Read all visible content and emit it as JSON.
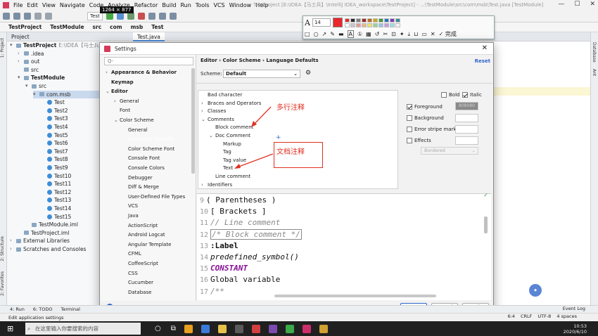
{
  "menubar": [
    "File",
    "Edit",
    "View",
    "Navigate",
    "Code",
    "Analyze",
    "Refactor",
    "Build",
    "Run",
    "Tools",
    "VCS",
    "Window",
    "Help"
  ],
  "window_title": "TestProject [E:\\IDEA【马士兵】\\IntelliJ IDEA_workspace\\TestProject] - ...\\TestModule\\src\\com\\msb\\Test.java [TestModule]",
  "toolbar": {
    "run_config": "Test",
    "dimensions": "1264 × 877"
  },
  "breadcrumbs": [
    "TestProject",
    "TestModule",
    "src",
    "com",
    "msb",
    "Test"
  ],
  "project_panel": {
    "title": "Project",
    "tab": "Test.java",
    "root_label": "TestProject",
    "root_path": "E:\\IDEA【马士兵】",
    "items": [
      "TestProject",
      ".idea",
      "out",
      "src",
      "TestModule",
      "src",
      "com.msb",
      "Test",
      "Test2",
      "Test3",
      "Test4",
      "Test5",
      "Test6",
      "Test7",
      "Test8",
      "Test9",
      "Test10",
      "Test11",
      "Test12",
      "Test13",
      "Test14",
      "Test15",
      "TestModule.iml",
      "TestProject.iml",
      "External Libraries",
      "Scratches and Consoles"
    ]
  },
  "side_tools": {
    "left": [
      "1: Project",
      "2: Structure",
      "2: Favorites"
    ],
    "right": [
      "Database",
      "Ant"
    ]
  },
  "snip_toolbar": {
    "font_size": "14",
    "done_label": "完成",
    "colors": [
      "#e8282c",
      "#2c2c2c",
      "#7f7f7f",
      "#9c2a20",
      "#bf6c1c",
      "#c8a620",
      "#3c9b3a",
      "#2c6fc0",
      "#7b3bb4",
      "#3a8a9a",
      "#ffffff",
      "#c8c8c8",
      "#e29b9a",
      "#ebb88e",
      "#eee26a",
      "#9bd39a",
      "#9bc3e8",
      "#c49ce0",
      "#9be0e8",
      "#f4f4f4"
    ]
  },
  "dialog": {
    "title": "Settings",
    "search_placeholder": "Q-",
    "breadcrumb": "Editor  ›  Color Scheme  ›  Language Defaults",
    "reset": "Reset",
    "scheme_label": "Scheme:",
    "scheme_value": "Default",
    "nav": [
      {
        "label": "Appearance & Behavior",
        "bold": true,
        "arrow": "›",
        "indent": 0
      },
      {
        "label": "Keymap",
        "bold": true,
        "arrow": "",
        "indent": 0
      },
      {
        "label": "Editor",
        "bold": true,
        "arrow": "⌄",
        "indent": 0
      },
      {
        "label": "General",
        "bold": false,
        "arrow": "›",
        "indent": 1
      },
      {
        "label": "Font",
        "bold": false,
        "arrow": "",
        "indent": 1
      },
      {
        "label": "Color Scheme",
        "bold": false,
        "arrow": "⌄",
        "indent": 1
      },
      {
        "label": "General",
        "bold": false,
        "arrow": "",
        "indent": 2
      },
      {
        "label": "Language Defaults",
        "bold": false,
        "arrow": "",
        "indent": 2,
        "selected": true
      },
      {
        "label": "Color Scheme Font",
        "bold": false,
        "arrow": "",
        "indent": 2
      },
      {
        "label": "Console Font",
        "bold": false,
        "arrow": "",
        "indent": 2
      },
      {
        "label": "Console Colors",
        "bold": false,
        "arrow": "",
        "indent": 2
      },
      {
        "label": "Debugger",
        "bold": false,
        "arrow": "",
        "indent": 2
      },
      {
        "label": "Diff & Merge",
        "bold": false,
        "arrow": "",
        "indent": 2
      },
      {
        "label": "User-Defined File Types",
        "bold": false,
        "arrow": "",
        "indent": 2
      },
      {
        "label": "VCS",
        "bold": false,
        "arrow": "",
        "indent": 2
      },
      {
        "label": "Java",
        "bold": false,
        "arrow": "",
        "indent": 2
      },
      {
        "label": "ActionScript",
        "bold": false,
        "arrow": "",
        "indent": 2
      },
      {
        "label": "Android Logcat",
        "bold": false,
        "arrow": "",
        "indent": 2
      },
      {
        "label": "Angular Template",
        "bold": false,
        "arrow": "",
        "indent": 2
      },
      {
        "label": "CFML",
        "bold": false,
        "arrow": "",
        "indent": 2
      },
      {
        "label": "CoffeeScript",
        "bold": false,
        "arrow": "",
        "indent": 2
      },
      {
        "label": "CSS",
        "bold": false,
        "arrow": "",
        "indent": 2
      },
      {
        "label": "Cucumber",
        "bold": false,
        "arrow": "",
        "indent": 2
      },
      {
        "label": "Database",
        "bold": false,
        "arrow": "",
        "indent": 2
      }
    ],
    "attr_tree": [
      {
        "label": "Bad character",
        "arrow": "",
        "indent": 0
      },
      {
        "label": "Braces and Operators",
        "arrow": "›",
        "indent": 0
      },
      {
        "label": "Classes",
        "arrow": "›",
        "indent": 0
      },
      {
        "label": "Comments",
        "arrow": "⌄",
        "indent": 0
      },
      {
        "label": "Block comment",
        "arrow": "",
        "indent": 1,
        "selected": true
      },
      {
        "label": "Doc Comment",
        "arrow": "⌄",
        "indent": 1
      },
      {
        "label": "Markup",
        "arrow": "",
        "indent": 2
      },
      {
        "label": "Tag",
        "arrow": "",
        "indent": 2
      },
      {
        "label": "Tag value",
        "arrow": "",
        "indent": 2
      },
      {
        "label": "Text",
        "arrow": "",
        "indent": 2
      },
      {
        "label": "Line comment",
        "arrow": "",
        "indent": 1
      },
      {
        "label": "Identifiers",
        "arrow": "›",
        "indent": 0
      }
    ],
    "options": {
      "bold": "Bold",
      "italic": "Italic",
      "foreground": "Foreground",
      "foreground_value": "808080",
      "background": "Background",
      "error_stripe": "Error stripe mark",
      "effects": "Effects",
      "effects_value": "Bordered"
    },
    "preview_lines": [
      {
        "num": "9",
        "text": "( Parentheses )",
        "style": "plain"
      },
      {
        "num": "10",
        "text": "[ Brackets ]",
        "style": "plain"
      },
      {
        "num": "11",
        "text": "// Line comment",
        "style": "comment"
      },
      {
        "num": "12",
        "text": "/* Block comment */",
        "style": "block"
      },
      {
        "num": "13",
        "text": ":Label",
        "style": "label"
      },
      {
        "num": "14",
        "text": "predefined_symbol()",
        "style": "italic"
      },
      {
        "num": "15",
        "text": "CONSTANT",
        "style": "constant"
      },
      {
        "num": "16",
        "text": "Global variable",
        "style": "plain"
      },
      {
        "num": "17",
        "text": "/**",
        "style": "comment"
      }
    ],
    "buttons": {
      "ok": "OK",
      "cancel": "Cancel",
      "apply": "Apply",
      "help": "?"
    }
  },
  "annotations": {
    "block_note": "多行注释",
    "doc_note": "文档注释"
  },
  "bottom_tabs": [
    "4: Run",
    "6: TODO",
    "Terminal"
  ],
  "event_log": "Event Log",
  "status": {
    "left": "Edit application settings",
    "right": [
      "6:4",
      "CRLF",
      "UTF-8",
      "4 spaces"
    ]
  },
  "taskbar": {
    "search_placeholder": "在这里输入你要搜索的内容",
    "time": "10:53",
    "date": "2020/6/10"
  }
}
